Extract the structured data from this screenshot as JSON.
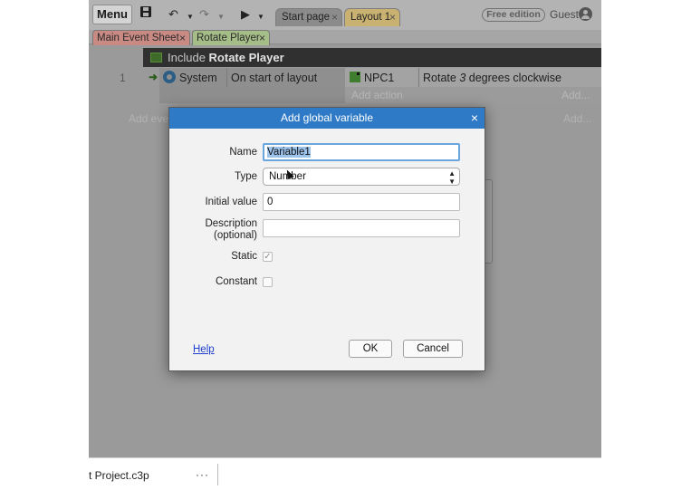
{
  "toolbar": {
    "menu_label": "Menu",
    "tabs": [
      {
        "label": "Start page",
        "close": "×"
      },
      {
        "label": "Layout 1",
        "close": "×"
      }
    ],
    "edition": "Free edition",
    "user": "Guest"
  },
  "sheet_tabs": [
    {
      "label": "Main Event Sheet",
      "close": "×"
    },
    {
      "label": "Rotate Player",
      "close": "×"
    }
  ],
  "event_sheet": {
    "include_prefix": "Include",
    "include_name": "Rotate Player",
    "row_number": "1",
    "condition_object": "System",
    "condition_text": "On start of layout",
    "action_object": "NPC1",
    "action_pre": "Rotate",
    "action_num": "3",
    "action_post": "degrees clockwise",
    "add_action": "Add action",
    "add_dots": "Add...",
    "add_event": "Add eve"
  },
  "dialog": {
    "title": "Add global variable",
    "close": "×",
    "name_label": "Name",
    "name_value": "Variable1",
    "type_label": "Type",
    "type_value": "Number",
    "initial_label": "Initial value",
    "initial_value": "0",
    "desc_label_1": "Description",
    "desc_label_2": "(optional)",
    "desc_value": "",
    "static_label": "Static",
    "static_checked": "✓",
    "constant_label": "Constant",
    "help": "Help",
    "ok": "OK",
    "cancel": "Cancel"
  },
  "status_bar": {
    "project": "t Project.c3p",
    "more": "···"
  },
  "colors": {
    "dialog_title_bar": "#2f7ac6",
    "include_bar": "#303030",
    "main_sheet_tab": "#c98a84",
    "rotate_sheet_tab": "#a5bd87",
    "layout_tab": "#c9b271"
  }
}
